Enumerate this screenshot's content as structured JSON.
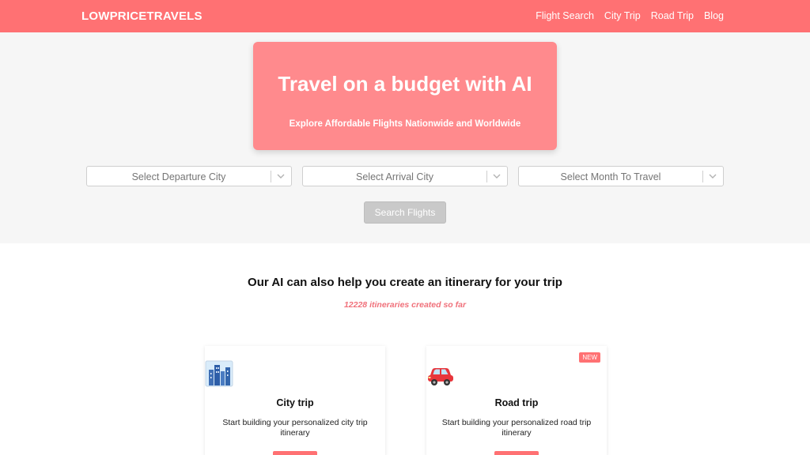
{
  "brand": "LOWPRICETRAVELS",
  "nav": {
    "flight_search": "Flight Search",
    "city_trip": "City Trip",
    "road_trip": "Road Trip",
    "blog": "Blog"
  },
  "hero": {
    "title": "Travel on a budget with AI",
    "subtitle": "Explore Affordable Flights Nationwide and Worldwide"
  },
  "search": {
    "departure_placeholder": "Select Departure City",
    "arrival_placeholder": "Select Arrival City",
    "month_placeholder": "Select Month To Travel",
    "button_label": "Search Flights"
  },
  "itinerary": {
    "title": "Our AI can also help you create an itinerary for your trip",
    "count_text": "12228 itineraries created so far"
  },
  "cards": [
    {
      "icon": "city-skyline-icon",
      "title": "City trip",
      "description": "Start building your personalized city trip itinerary"
    },
    {
      "icon": "car-icon",
      "title": "Road trip",
      "description": "Start building your personalized road trip itinerary",
      "badge": "NEW"
    }
  ],
  "colors": {
    "accent": "#ff7173",
    "hero_box": "#ff8a8d",
    "hero_bg": "#f6f6f6",
    "count_text": "#f0707a",
    "button_disabled": "#c9c9c9"
  }
}
